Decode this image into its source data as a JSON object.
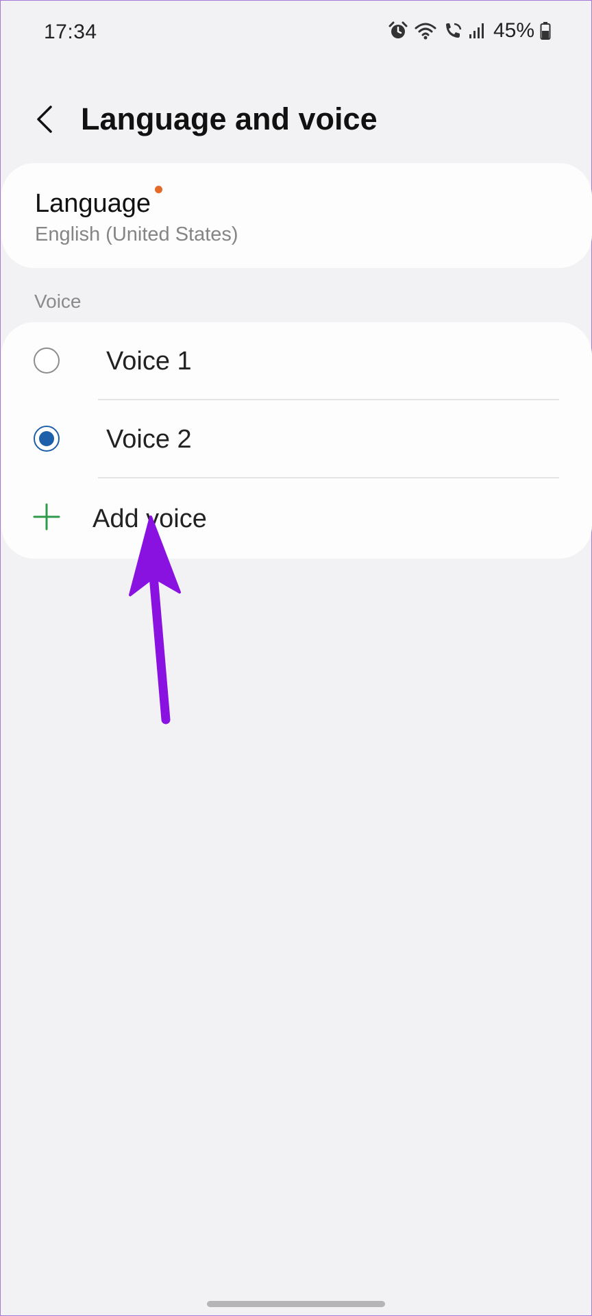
{
  "status_bar": {
    "time": "17:34",
    "battery": "45%",
    "icons": [
      "alarm-icon",
      "wifi-icon",
      "wifi-calling-icon",
      "signal-icon",
      "battery-icon"
    ]
  },
  "header": {
    "title": "Language and voice",
    "back_icon": "chevron-left-icon"
  },
  "language": {
    "title": "Language",
    "value": "English (United States)",
    "badge_color": "#e46a2a"
  },
  "voice_section": {
    "label": "Voice",
    "options": [
      {
        "label": "Voice 1",
        "selected": false
      },
      {
        "label": "Voice 2",
        "selected": true
      }
    ],
    "add_label": "Add voice",
    "accent_color": "#1d5fa8",
    "add_icon_color": "#2e9a4a"
  },
  "annotation": {
    "arrow_color": "#8a12e0"
  }
}
